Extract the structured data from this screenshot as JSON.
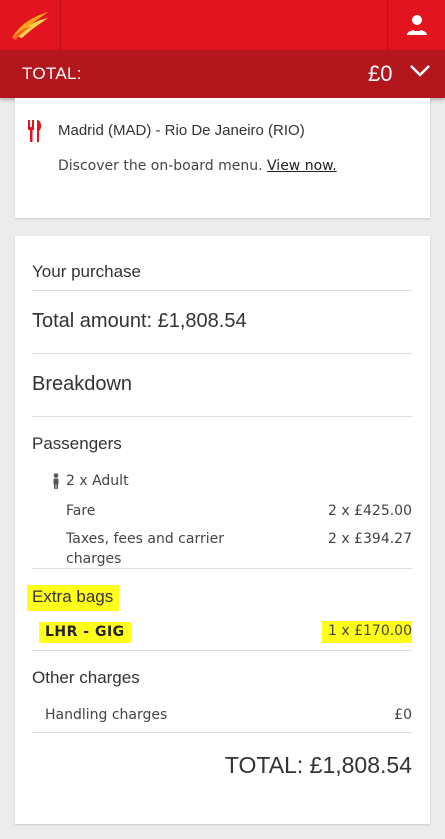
{
  "header": {
    "logo": "iberia-logo",
    "user_icon": "user-icon"
  },
  "total_bar": {
    "label": "TOTAL:",
    "value": "£0",
    "chevron_icon": "chevron-down-icon"
  },
  "flight_card": {
    "icon": "cutlery-icon",
    "route": "Madrid (MAD) - Rio De Janeiro (RIO)",
    "menu_text": "Discover the on-board menu.",
    "menu_link": "View now."
  },
  "purchase": {
    "title": "Your purchase",
    "total_amount": "Total amount: £1,808.54",
    "breakdown_title": "Breakdown",
    "passengers_title": "Passengers",
    "passenger_icon": "person-icon",
    "passenger_count": "2 x Adult",
    "fare_label": "Fare",
    "fare_value": "2 x £425.00",
    "taxes_label_line1": "Taxes, fees and carrier",
    "taxes_label_line2": "charges",
    "taxes_value": "2 x £394.27",
    "extra_bags_title": "Extra bags",
    "bag_route": "LHR - GIG",
    "bag_value": "1 x £170.00",
    "other_charges_title": "Other charges",
    "handling_label": "Handling charges",
    "handling_value": "£0",
    "grand_total": "TOTAL: £1,808.54"
  },
  "colors": {
    "brand_red": "#e2141f",
    "dark_red": "#b3161c",
    "logo_orange": "#f7a21b",
    "highlight": "#ffff1a"
  }
}
